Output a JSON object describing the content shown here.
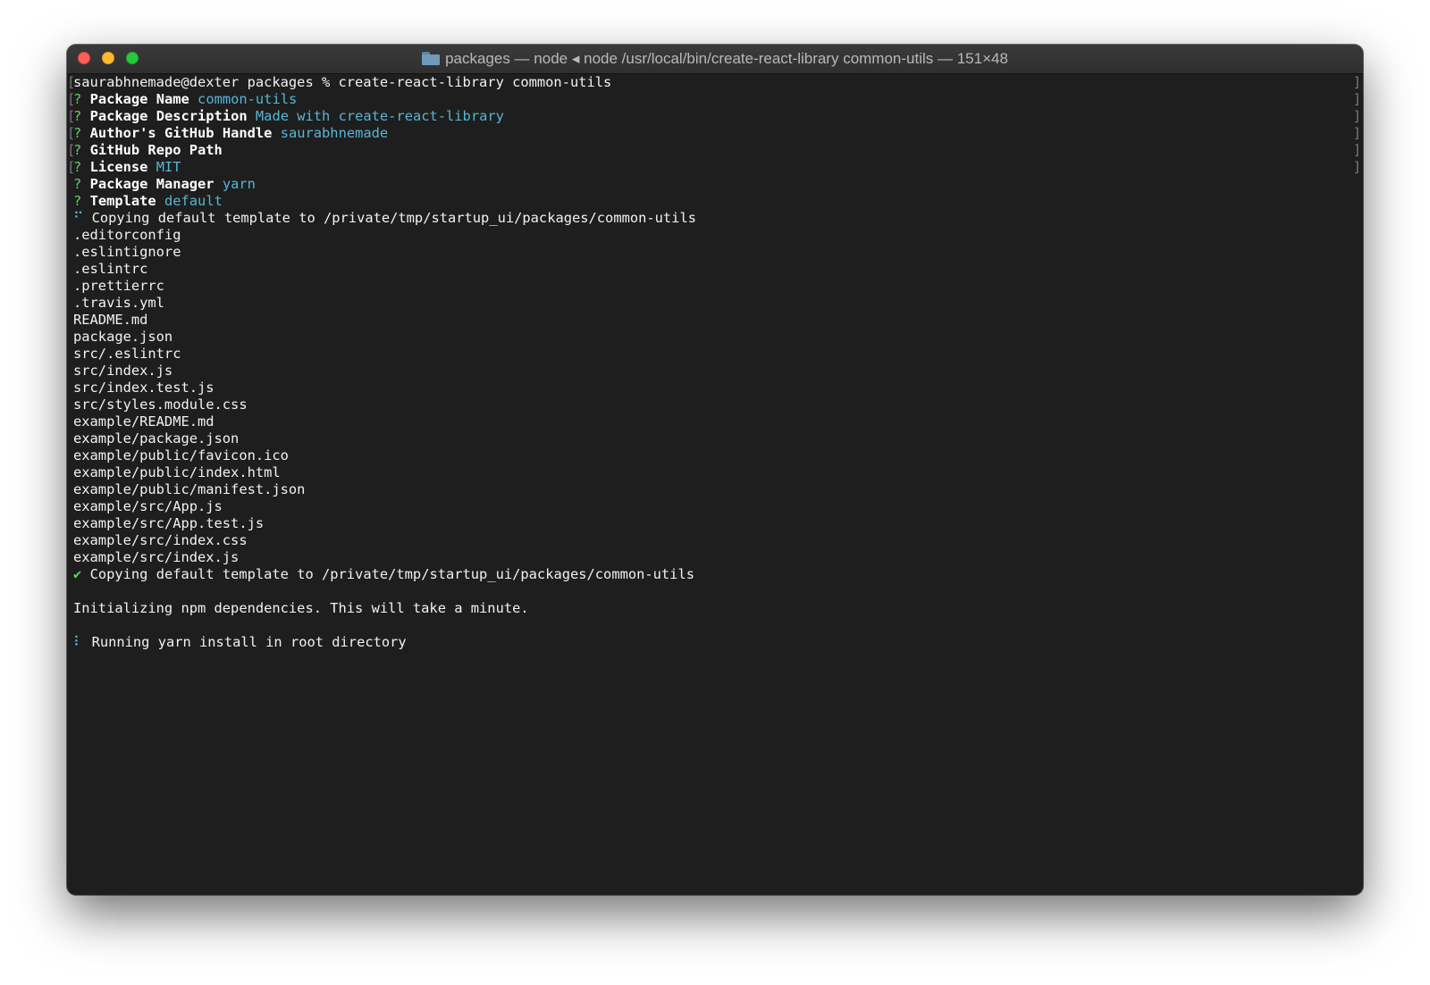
{
  "window": {
    "title_prefix": "packages — node",
    "title_separator": "◂",
    "title_suffix": "node /usr/local/bin/create-react-library common-utils — 151×48"
  },
  "terminal": {
    "prompt_line": "saurabhnemade@dexter packages % create-react-library common-utils",
    "questions": [
      {
        "mark": "?",
        "label": "Package Name",
        "answer": "common-utils"
      },
      {
        "mark": "?",
        "label": "Package Description",
        "answer": "Made with create-react-library"
      },
      {
        "mark": "?",
        "label": "Author's GitHub Handle",
        "answer": "saurabhnemade"
      },
      {
        "mark": "?",
        "label": "GitHub Repo Path",
        "answer": ""
      },
      {
        "mark": "?",
        "label": "License",
        "answer": "MIT"
      },
      {
        "mark": "?",
        "label": "Package Manager",
        "answer": "yarn"
      },
      {
        "mark": "?",
        "label": "Template",
        "answer": "default"
      }
    ],
    "copy_status": {
      "symbol": "⠋",
      "text": "Copying default template to /private/tmp/startup_ui/packages/common-utils"
    },
    "files": [
      ".editorconfig",
      ".eslintignore",
      ".eslintrc",
      ".prettierrc",
      ".travis.yml",
      "README.md",
      "package.json",
      "src/.eslintrc",
      "src/index.js",
      "src/index.test.js",
      "src/styles.module.css",
      "example/README.md",
      "example/package.json",
      "example/public/favicon.ico",
      "example/public/index.html",
      "example/public/manifest.json",
      "example/src/App.js",
      "example/src/App.test.js",
      "example/src/index.css",
      "example/src/index.js"
    ],
    "copy_done": {
      "symbol": "✔",
      "text": "Copying default template to /private/tmp/startup_ui/packages/common-utils"
    },
    "init_message": "Initializing npm dependencies. This will take a minute.",
    "running": {
      "symbol": "⠇",
      "text": "Running yarn install in root directory"
    }
  },
  "colors": {
    "background": "#1e1e1e",
    "text": "#f2f2f2",
    "answer": "#56b6d6",
    "question_mark": "#5fd35f"
  }
}
